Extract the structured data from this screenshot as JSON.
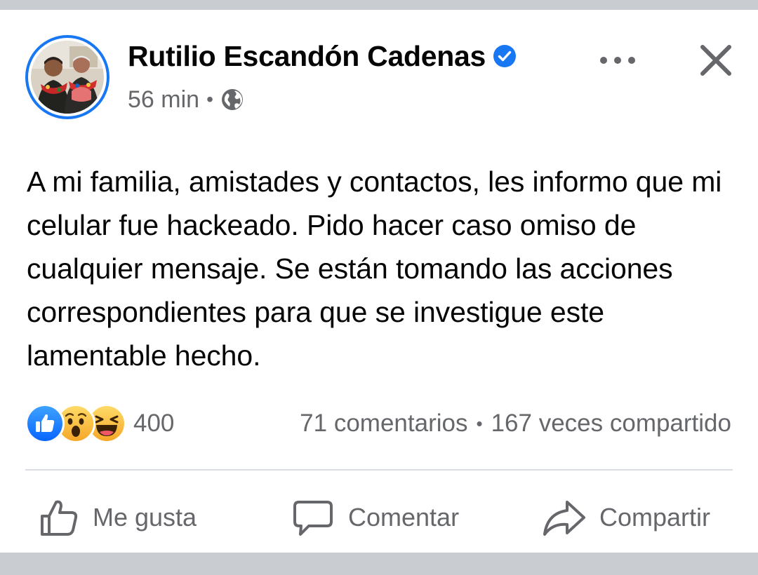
{
  "post": {
    "author_name": "Rutilio Escandón Cadenas",
    "verified": true,
    "timestamp": "56 min",
    "meta_separator": "•",
    "audience_icon": "globe-icon",
    "text": "A mi familia, amistades y contactos, les informo que mi celular fue hackeado. Pido hacer caso omiso de cualquier mensaje. Se están tomando las acciones correspondientes para que se investigue este lamentable hecho."
  },
  "header_actions": {
    "more_icon": "more-options-icon",
    "close_icon": "close-icon"
  },
  "reactions": {
    "icons": [
      "like-reaction-icon",
      "wow-reaction-icon",
      "haha-reaction-icon"
    ],
    "count": "400"
  },
  "stats": {
    "comments": "71 comentarios",
    "separator": "•",
    "shares": "167 veces compartido"
  },
  "actions": {
    "like_label": "Me gusta",
    "comment_label": "Comentar",
    "share_label": "Compartir"
  },
  "colors": {
    "accent": "#1877f2",
    "text_primary": "#050505",
    "text_secondary": "#65676b",
    "background": "#c9ccd1",
    "card": "#ffffff",
    "divider": "#dadde1"
  }
}
